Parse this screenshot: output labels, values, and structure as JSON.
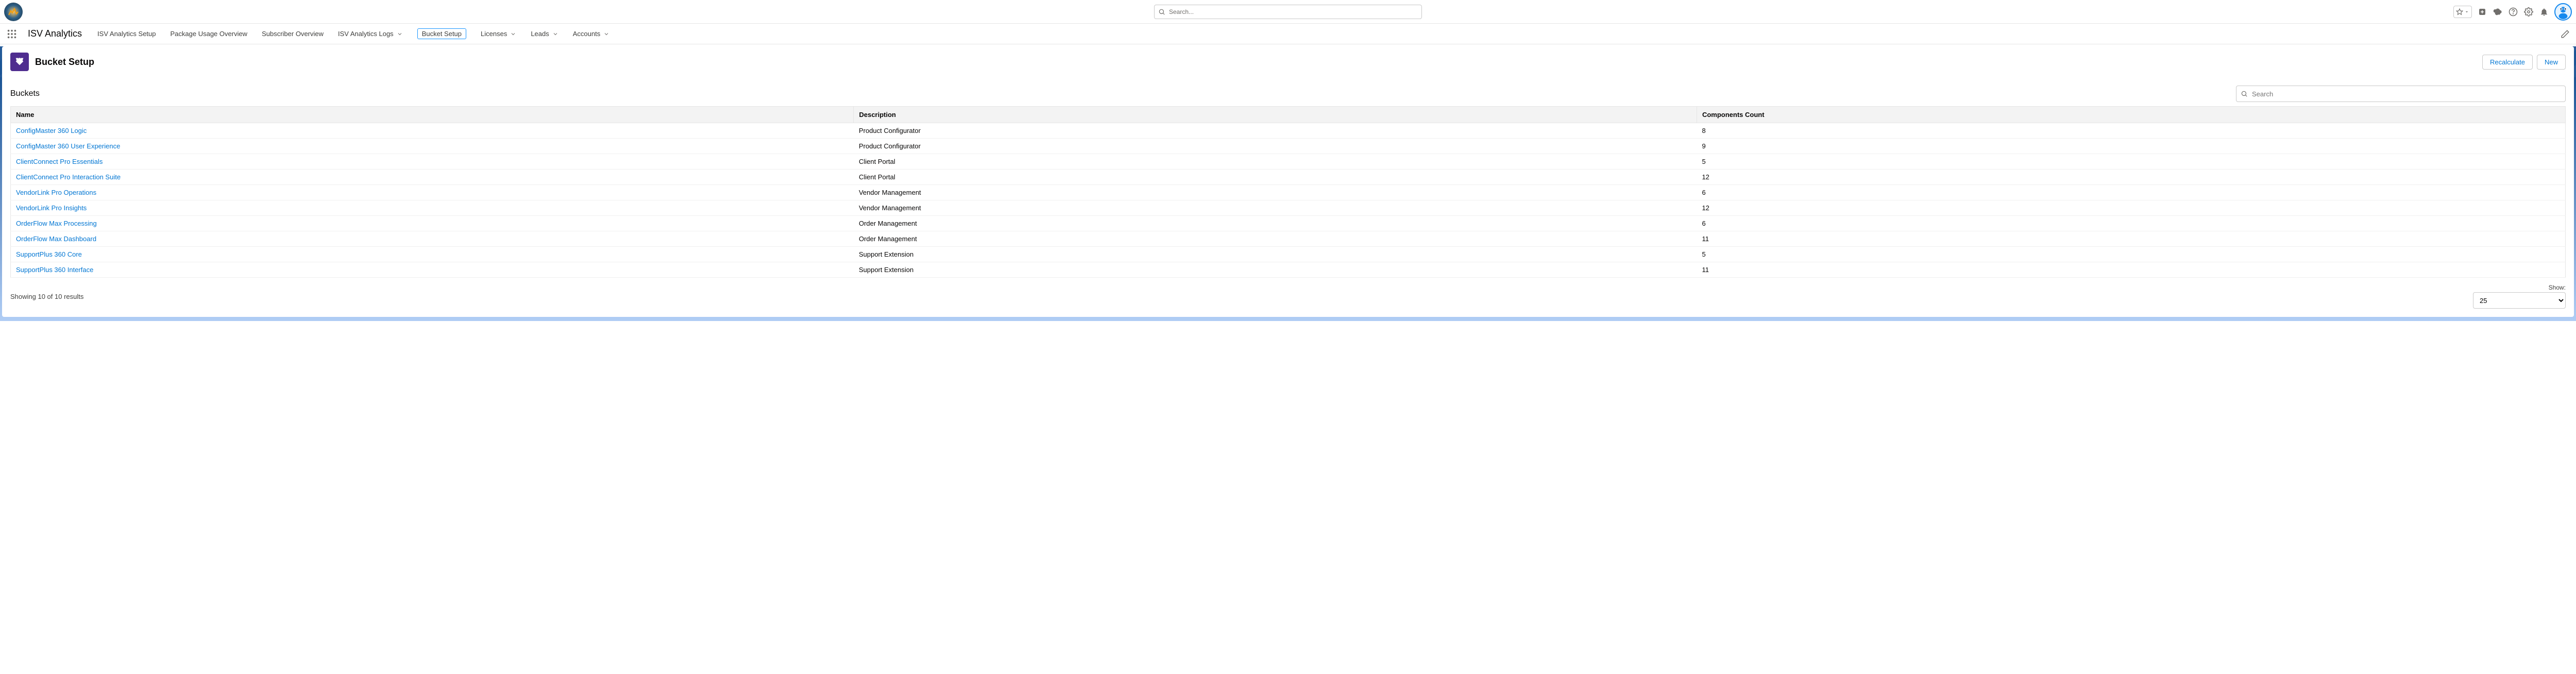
{
  "global_search": {
    "placeholder": "Search..."
  },
  "app_name": "ISV Analytics",
  "nav": {
    "items": [
      {
        "label": "ISV Analytics Setup",
        "dropdown": false,
        "active": false
      },
      {
        "label": "Package Usage Overview",
        "dropdown": false,
        "active": false
      },
      {
        "label": "Subscriber Overview",
        "dropdown": false,
        "active": false
      },
      {
        "label": "ISV Analytics Logs",
        "dropdown": true,
        "active": false
      },
      {
        "label": "Bucket Setup",
        "dropdown": false,
        "active": true
      },
      {
        "label": "Licenses",
        "dropdown": true,
        "active": false
      },
      {
        "label": "Leads",
        "dropdown": true,
        "active": false
      },
      {
        "label": "Accounts",
        "dropdown": true,
        "active": false
      }
    ]
  },
  "page": {
    "title": "Bucket Setup",
    "actions": {
      "recalculate": "Recalculate",
      "new": "New"
    }
  },
  "section": {
    "title": "Buckets",
    "search_placeholder": "Search"
  },
  "table": {
    "columns": {
      "name": "Name",
      "description": "Description",
      "count": "Components Count"
    },
    "rows": [
      {
        "name": "ConfigMaster 360 Logic",
        "description": "Product Configurator",
        "count": "8"
      },
      {
        "name": "ConfigMaster 360 User Experience",
        "description": "Product Configurator",
        "count": "9"
      },
      {
        "name": "ClientConnect Pro Essentials",
        "description": "Client Portal",
        "count": "5"
      },
      {
        "name": "ClientConnect Pro Interaction Suite",
        "description": "Client Portal",
        "count": "12"
      },
      {
        "name": "VendorLink Pro Operations",
        "description": "Vendor Management",
        "count": "6"
      },
      {
        "name": "VendorLink Pro Insights",
        "description": "Vendor Management",
        "count": "12"
      },
      {
        "name": "OrderFlow Max Processing",
        "description": "Order Management",
        "count": "6"
      },
      {
        "name": "OrderFlow Max Dashboard",
        "description": "Order Management",
        "count": "11"
      },
      {
        "name": "SupportPlus 360 Core",
        "description": "Support Extension",
        "count": "5"
      },
      {
        "name": "SupportPlus 360 Interface",
        "description": "Support Extension",
        "count": "11"
      }
    ],
    "results_text": "Showing 10 of 10 results",
    "show_label": "Show:",
    "show_value": "25"
  }
}
